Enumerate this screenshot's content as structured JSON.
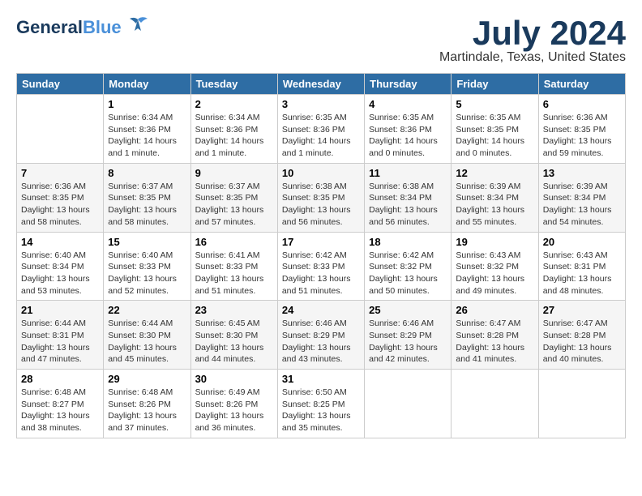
{
  "header": {
    "logo_general": "General",
    "logo_blue": "Blue",
    "month": "July 2024",
    "location": "Martindale, Texas, United States"
  },
  "days_of_week": [
    "Sunday",
    "Monday",
    "Tuesday",
    "Wednesday",
    "Thursday",
    "Friday",
    "Saturday"
  ],
  "weeks": [
    [
      {
        "day": "",
        "info": ""
      },
      {
        "day": "1",
        "info": "Sunrise: 6:34 AM\nSunset: 8:36 PM\nDaylight: 14 hours\nand 1 minute."
      },
      {
        "day": "2",
        "info": "Sunrise: 6:34 AM\nSunset: 8:36 PM\nDaylight: 14 hours\nand 1 minute."
      },
      {
        "day": "3",
        "info": "Sunrise: 6:35 AM\nSunset: 8:36 PM\nDaylight: 14 hours\nand 1 minute."
      },
      {
        "day": "4",
        "info": "Sunrise: 6:35 AM\nSunset: 8:36 PM\nDaylight: 14 hours\nand 0 minutes."
      },
      {
        "day": "5",
        "info": "Sunrise: 6:35 AM\nSunset: 8:35 PM\nDaylight: 14 hours\nand 0 minutes."
      },
      {
        "day": "6",
        "info": "Sunrise: 6:36 AM\nSunset: 8:35 PM\nDaylight: 13 hours\nand 59 minutes."
      }
    ],
    [
      {
        "day": "7",
        "info": "Sunrise: 6:36 AM\nSunset: 8:35 PM\nDaylight: 13 hours\nand 58 minutes."
      },
      {
        "day": "8",
        "info": "Sunrise: 6:37 AM\nSunset: 8:35 PM\nDaylight: 13 hours\nand 58 minutes."
      },
      {
        "day": "9",
        "info": "Sunrise: 6:37 AM\nSunset: 8:35 PM\nDaylight: 13 hours\nand 57 minutes."
      },
      {
        "day": "10",
        "info": "Sunrise: 6:38 AM\nSunset: 8:35 PM\nDaylight: 13 hours\nand 56 minutes."
      },
      {
        "day": "11",
        "info": "Sunrise: 6:38 AM\nSunset: 8:34 PM\nDaylight: 13 hours\nand 56 minutes."
      },
      {
        "day": "12",
        "info": "Sunrise: 6:39 AM\nSunset: 8:34 PM\nDaylight: 13 hours\nand 55 minutes."
      },
      {
        "day": "13",
        "info": "Sunrise: 6:39 AM\nSunset: 8:34 PM\nDaylight: 13 hours\nand 54 minutes."
      }
    ],
    [
      {
        "day": "14",
        "info": "Sunrise: 6:40 AM\nSunset: 8:34 PM\nDaylight: 13 hours\nand 53 minutes."
      },
      {
        "day": "15",
        "info": "Sunrise: 6:40 AM\nSunset: 8:33 PM\nDaylight: 13 hours\nand 52 minutes."
      },
      {
        "day": "16",
        "info": "Sunrise: 6:41 AM\nSunset: 8:33 PM\nDaylight: 13 hours\nand 51 minutes."
      },
      {
        "day": "17",
        "info": "Sunrise: 6:42 AM\nSunset: 8:33 PM\nDaylight: 13 hours\nand 51 minutes."
      },
      {
        "day": "18",
        "info": "Sunrise: 6:42 AM\nSunset: 8:32 PM\nDaylight: 13 hours\nand 50 minutes."
      },
      {
        "day": "19",
        "info": "Sunrise: 6:43 AM\nSunset: 8:32 PM\nDaylight: 13 hours\nand 49 minutes."
      },
      {
        "day": "20",
        "info": "Sunrise: 6:43 AM\nSunset: 8:31 PM\nDaylight: 13 hours\nand 48 minutes."
      }
    ],
    [
      {
        "day": "21",
        "info": "Sunrise: 6:44 AM\nSunset: 8:31 PM\nDaylight: 13 hours\nand 47 minutes."
      },
      {
        "day": "22",
        "info": "Sunrise: 6:44 AM\nSunset: 8:30 PM\nDaylight: 13 hours\nand 45 minutes."
      },
      {
        "day": "23",
        "info": "Sunrise: 6:45 AM\nSunset: 8:30 PM\nDaylight: 13 hours\nand 44 minutes."
      },
      {
        "day": "24",
        "info": "Sunrise: 6:46 AM\nSunset: 8:29 PM\nDaylight: 13 hours\nand 43 minutes."
      },
      {
        "day": "25",
        "info": "Sunrise: 6:46 AM\nSunset: 8:29 PM\nDaylight: 13 hours\nand 42 minutes."
      },
      {
        "day": "26",
        "info": "Sunrise: 6:47 AM\nSunset: 8:28 PM\nDaylight: 13 hours\nand 41 minutes."
      },
      {
        "day": "27",
        "info": "Sunrise: 6:47 AM\nSunset: 8:28 PM\nDaylight: 13 hours\nand 40 minutes."
      }
    ],
    [
      {
        "day": "28",
        "info": "Sunrise: 6:48 AM\nSunset: 8:27 PM\nDaylight: 13 hours\nand 38 minutes."
      },
      {
        "day": "29",
        "info": "Sunrise: 6:48 AM\nSunset: 8:26 PM\nDaylight: 13 hours\nand 37 minutes."
      },
      {
        "day": "30",
        "info": "Sunrise: 6:49 AM\nSunset: 8:26 PM\nDaylight: 13 hours\nand 36 minutes."
      },
      {
        "day": "31",
        "info": "Sunrise: 6:50 AM\nSunset: 8:25 PM\nDaylight: 13 hours\nand 35 minutes."
      },
      {
        "day": "",
        "info": ""
      },
      {
        "day": "",
        "info": ""
      },
      {
        "day": "",
        "info": ""
      }
    ]
  ]
}
